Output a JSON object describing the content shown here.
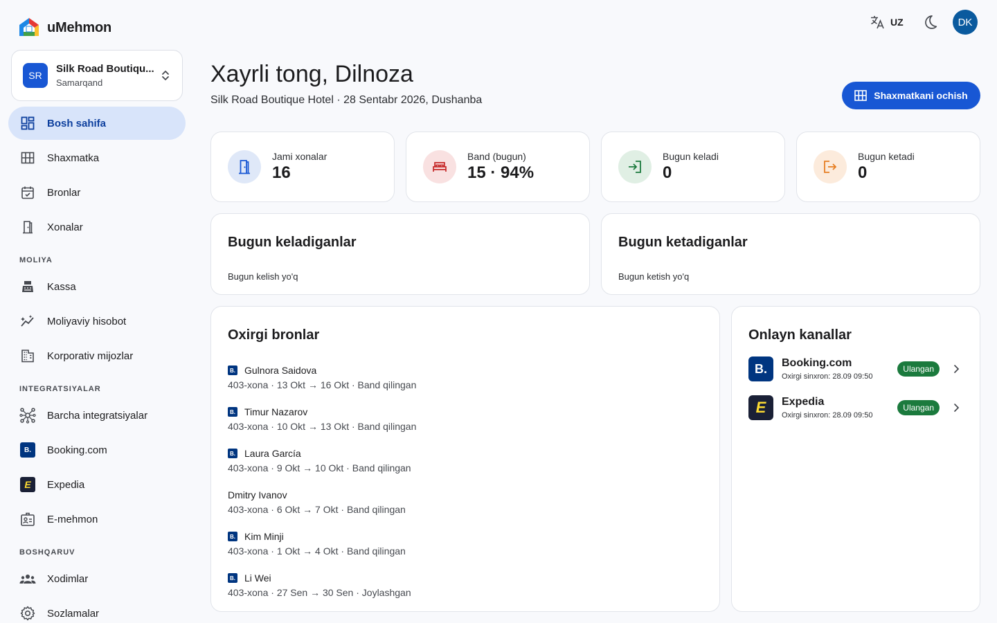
{
  "brand": {
    "name": "uMehmon"
  },
  "hotel": {
    "initials": "SR",
    "name": "Silk Road Boutiqu...",
    "city": "Samarqand"
  },
  "nav": {
    "main": [
      {
        "label": "Bosh sahifa",
        "icon": "dashboard-icon",
        "active": true
      },
      {
        "label": "Shaxmatka",
        "icon": "grid-icon"
      },
      {
        "label": "Bronlar",
        "icon": "calendar-check-icon"
      },
      {
        "label": "Xonalar",
        "icon": "door-icon"
      }
    ],
    "sections": {
      "finance": "MOLIYA",
      "integrations": "INTEGRATSIYALAR",
      "management": "BOSHQARUV"
    },
    "finance": [
      {
        "label": "Kassa",
        "icon": "cash-register-icon"
      },
      {
        "label": "Moliyaviy hisobot",
        "icon": "chart-sparkle-icon"
      },
      {
        "label": "Korporativ mijozlar",
        "icon": "building-icon"
      }
    ],
    "integrations": [
      {
        "label": "Barcha integratsiyalar",
        "icon": "hub-icon"
      },
      {
        "label": "Booking.com",
        "icon": "booking-logo-icon"
      },
      {
        "label": "Expedia",
        "icon": "expedia-logo-icon"
      },
      {
        "label": "E-mehmon",
        "icon": "id-card-icon"
      }
    ],
    "management": [
      {
        "label": "Xodimlar",
        "icon": "people-icon"
      },
      {
        "label": "Sozlamalar",
        "icon": "gear-icon"
      }
    ]
  },
  "topbar": {
    "language": "UZ",
    "user_initials": "DK"
  },
  "header": {
    "greeting": "Xayrli tong, Dilnoza",
    "subtitle": "Silk Road Boutique Hotel · 28 Sentabr 2026, Dushanba",
    "open_grid_button": "Shaxmatkani ochish"
  },
  "stats": [
    {
      "label": "Jami xonalar",
      "value": "16"
    },
    {
      "label": "Band (bugun)",
      "value": "15 · 94%"
    },
    {
      "label": "Bugun keladi",
      "value": "0"
    },
    {
      "label": "Bugun ketadi",
      "value": "0"
    }
  ],
  "arrivals": {
    "title": "Bugun keladiganlar",
    "empty": "Bugun kelish yo'q"
  },
  "departures": {
    "title": "Bugun ketadiganlar",
    "empty": "Bugun ketish yo'q"
  },
  "recent": {
    "title": "Oxirgi bronlar",
    "items": [
      {
        "guest": "Gulnora Saidova",
        "meta": "403-xona · 13 Okt → 16 Okt · Band qilingan",
        "booking": true
      },
      {
        "guest": "Timur Nazarov",
        "meta": "403-xona · 10 Okt → 13 Okt · Band qilingan",
        "booking": true
      },
      {
        "guest": "Laura García",
        "meta": "403-xona · 9 Okt → 10 Okt · Band qilingan",
        "booking": true
      },
      {
        "guest": "Dmitry Ivanov",
        "meta": "403-xona · 6 Okt → 7 Okt · Band qilingan",
        "booking": false
      },
      {
        "guest": "Kim Minji",
        "meta": "403-xona · 1 Okt → 4 Okt · Band qilingan",
        "booking": true
      },
      {
        "guest": "Li Wei",
        "meta": "403-xona · 27 Sen → 30 Sen · Joylashgan",
        "booking": true
      }
    ]
  },
  "channels": {
    "title": "Onlayn kanallar",
    "items": [
      {
        "name": "Booking.com",
        "logo": "B.",
        "sync": "Oxirgi sinxron: 28.09 09:50",
        "status": "Ulangan"
      },
      {
        "name": "Expedia",
        "logo": "E",
        "sync": "Oxirgi sinxron: 28.09 09:50",
        "status": "Ulangan"
      }
    ]
  },
  "colors": {
    "primary": "#1857d4",
    "active_nav": "#d8e4fa",
    "success": "#1b7a3d",
    "booking_blue": "#003580",
    "expedia_dark": "#1a2036",
    "expedia_yellow": "#fddb32"
  }
}
